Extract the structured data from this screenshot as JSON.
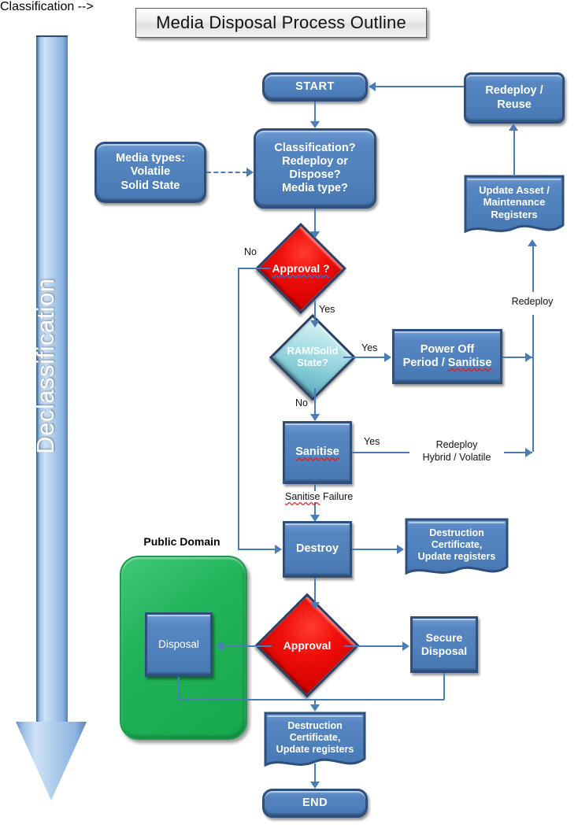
{
  "title": "Media Disposal Process Outline",
  "side_arrow": {
    "label": "Declassification"
  },
  "public_domain": {
    "label": "Public Domain"
  },
  "nodes": {
    "start": {
      "label": "START"
    },
    "media_types": {
      "line1": "Media types:",
      "line2": "Volatile",
      "line3": "Solid State"
    },
    "classification": {
      "line1": "Classification?",
      "line2": "Redeploy or",
      "line3": "Dispose?",
      "line4": "Media type?"
    },
    "redeploy_reuse": {
      "line1": "Redeploy /",
      "line2": "Reuse"
    },
    "update_asset": {
      "line1": "Update Asset /",
      "line2": "Maintenance",
      "line3": "Registers"
    },
    "approval_1": {
      "label": "Approval ?"
    },
    "ram_solid": {
      "line1": "RAM/Solid",
      "line2": "State?"
    },
    "power_off": {
      "line1": "Power Off",
      "line2_pre": "Period / ",
      "line2_word": "Sanitise"
    },
    "sanitise": {
      "label": "Sanitise"
    },
    "destroy": {
      "label": "Destroy"
    },
    "destruction_cert_1": {
      "line1": "Destruction",
      "line2": "Certificate,",
      "line3": "Update registers"
    },
    "disposal": {
      "label": "Disposal"
    },
    "approval_2": {
      "label": "Approval"
    },
    "secure_disposal": {
      "line1": "Secure",
      "line2": "Disposal"
    },
    "destruction_cert_2": {
      "line1": "Destruction",
      "line2": "Certificate,",
      "line3": "Update registers"
    },
    "end": {
      "label": "END"
    }
  },
  "edge_labels": {
    "approval_no": "No",
    "approval_yes": "Yes",
    "ram_yes": "Yes",
    "ram_no": "No",
    "sanitise_yes": "Yes",
    "sanitise_redeploy_1": "Redeploy",
    "sanitise_redeploy_2": "Hybrid / Volatile",
    "sanitise_failure_word": "Sanitise",
    "sanitise_failure_rest": " Failure",
    "redeploy_right": "Redeploy"
  },
  "colors": {
    "node_blue": "#5082bd",
    "node_border": "#2e4f7c",
    "decision_red": "#e00b06",
    "decision_cyan": "#a8dfe6",
    "public_domain_green": "#22b45a",
    "connector": "#4a7cb5",
    "arrow_light_blue": "#a9caea",
    "title_bg": "#ededed"
  }
}
